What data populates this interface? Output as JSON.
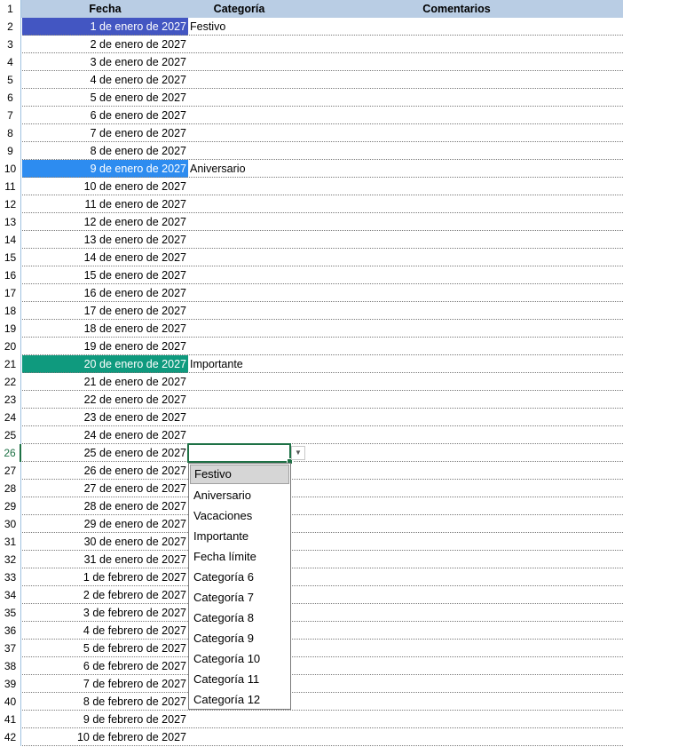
{
  "header": {
    "row_number": "1",
    "fecha": "Fecha",
    "categoria": "Categoría",
    "comentarios": "Comentarios"
  },
  "rows": [
    {
      "n": "2",
      "fecha": "1 de enero de 2027",
      "cat": "Festivo",
      "fill": "#4356c2"
    },
    {
      "n": "3",
      "fecha": "2 de enero de 2027",
      "cat": ""
    },
    {
      "n": "4",
      "fecha": "3 de enero de 2027",
      "cat": ""
    },
    {
      "n": "5",
      "fecha": "4 de enero de 2027",
      "cat": ""
    },
    {
      "n": "6",
      "fecha": "5 de enero de 2027",
      "cat": ""
    },
    {
      "n": "7",
      "fecha": "6 de enero de 2027",
      "cat": ""
    },
    {
      "n": "8",
      "fecha": "7 de enero de 2027",
      "cat": ""
    },
    {
      "n": "9",
      "fecha": "8 de enero de 2027",
      "cat": ""
    },
    {
      "n": "10",
      "fecha": "9 de enero de 2027",
      "cat": "Aniversario",
      "fill": "#2d8cf0"
    },
    {
      "n": "11",
      "fecha": "10 de enero de 2027",
      "cat": ""
    },
    {
      "n": "12",
      "fecha": "11 de enero de 2027",
      "cat": ""
    },
    {
      "n": "13",
      "fecha": "12 de enero de 2027",
      "cat": ""
    },
    {
      "n": "14",
      "fecha": "13 de enero de 2027",
      "cat": ""
    },
    {
      "n": "15",
      "fecha": "14 de enero de 2027",
      "cat": ""
    },
    {
      "n": "16",
      "fecha": "15 de enero de 2027",
      "cat": ""
    },
    {
      "n": "17",
      "fecha": "16 de enero de 2027",
      "cat": ""
    },
    {
      "n": "18",
      "fecha": "17 de enero de 2027",
      "cat": ""
    },
    {
      "n": "19",
      "fecha": "18 de enero de 2027",
      "cat": ""
    },
    {
      "n": "20",
      "fecha": "19 de enero de 2027",
      "cat": ""
    },
    {
      "n": "21",
      "fecha": "20 de enero de 2027",
      "cat": "Importante",
      "fill": "#0f9a7e"
    },
    {
      "n": "22",
      "fecha": "21 de enero de 2027",
      "cat": ""
    },
    {
      "n": "23",
      "fecha": "22 de enero de 2027",
      "cat": ""
    },
    {
      "n": "24",
      "fecha": "23 de enero de 2027",
      "cat": ""
    },
    {
      "n": "25",
      "fecha": "24 de enero de 2027",
      "cat": ""
    },
    {
      "n": "26",
      "fecha": "25 de enero de 2027",
      "cat": "",
      "active": true
    },
    {
      "n": "27",
      "fecha": "26 de enero de 2027",
      "cat": ""
    },
    {
      "n": "28",
      "fecha": "27 de enero de 2027",
      "cat": ""
    },
    {
      "n": "29",
      "fecha": "28 de enero de 2027",
      "cat": ""
    },
    {
      "n": "30",
      "fecha": "29 de enero de 2027",
      "cat": ""
    },
    {
      "n": "31",
      "fecha": "30 de enero de 2027",
      "cat": ""
    },
    {
      "n": "32",
      "fecha": "31 de enero de 2027",
      "cat": ""
    },
    {
      "n": "33",
      "fecha": "1 de febrero de 2027",
      "cat": ""
    },
    {
      "n": "34",
      "fecha": "2 de febrero de 2027",
      "cat": ""
    },
    {
      "n": "35",
      "fecha": "3 de febrero de 2027",
      "cat": ""
    },
    {
      "n": "36",
      "fecha": "4 de febrero de 2027",
      "cat": ""
    },
    {
      "n": "37",
      "fecha": "5 de febrero de 2027",
      "cat": ""
    },
    {
      "n": "38",
      "fecha": "6 de febrero de 2027",
      "cat": ""
    },
    {
      "n": "39",
      "fecha": "7 de febrero de 2027",
      "cat": ""
    },
    {
      "n": "40",
      "fecha": "8 de febrero de 2027",
      "cat": ""
    },
    {
      "n": "41",
      "fecha": "9 de febrero de 2027",
      "cat": ""
    },
    {
      "n": "42",
      "fecha": "10 de febrero de 2027",
      "cat": ""
    }
  ],
  "dropdown": {
    "icon": "chevron-down-icon",
    "options": [
      "Festivo",
      "Aniversario",
      "Vacaciones",
      "Importante",
      "Fecha límite",
      "Categoría 6",
      "Categoría 7",
      "Categoría 8",
      "Categoría 9",
      "Categoría 10",
      "Categoría 11",
      "Categoría 12"
    ],
    "highlighted": "Festivo"
  },
  "colors": {
    "header_bg": "#b9cde4",
    "selection_green": "#1e7145"
  }
}
